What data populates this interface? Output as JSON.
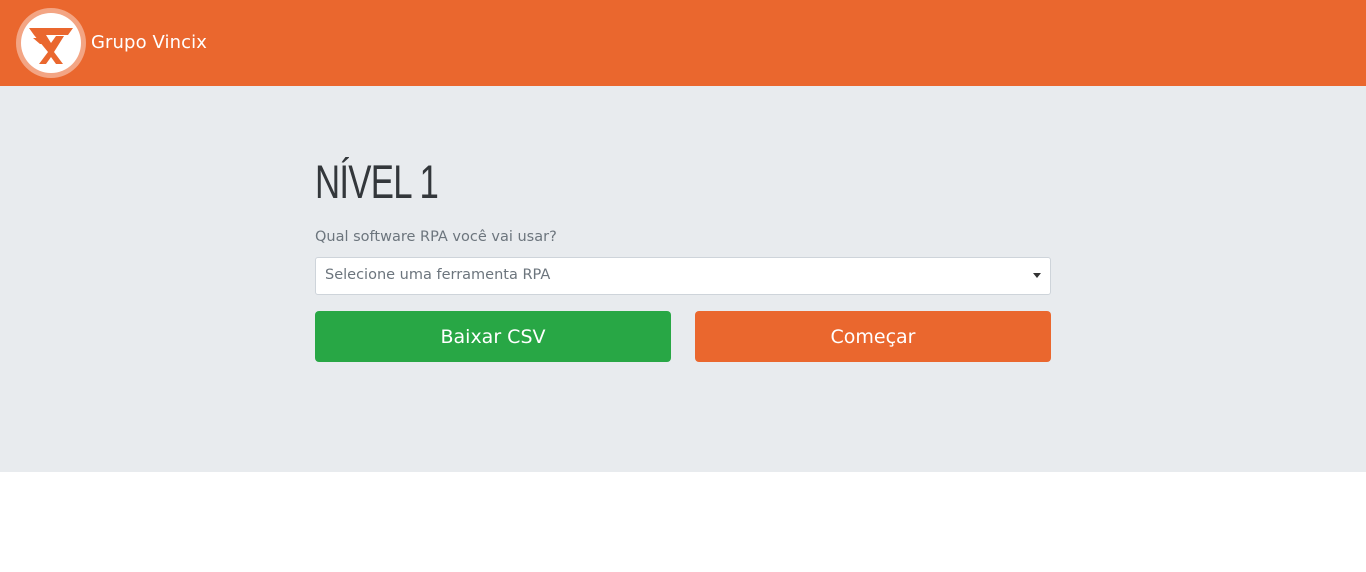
{
  "navbar": {
    "brand_name": "Grupo Vincix",
    "logo_icon": "vincix-v-logo-icon",
    "background_color": "#ea672e"
  },
  "main": {
    "title": "NÍVEL 1",
    "question": "Qual software RPA você vai usar?",
    "select": {
      "placeholder": "Selecione uma ferramenta RPA",
      "caret_icon": "caret-down-icon"
    },
    "buttons": {
      "download_label": "Baixar CSV",
      "download_color": "#28a745",
      "start_label": "Começar",
      "start_color": "#ea672e"
    },
    "background_color": "#e8ebee"
  }
}
